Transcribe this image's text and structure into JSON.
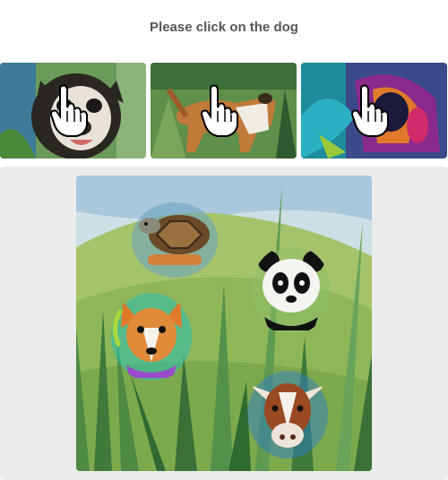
{
  "instruction": "Please click on the dog",
  "examples": [
    {
      "icon": "pointer-hand-icon",
      "subject": "dog"
    },
    {
      "icon": "pointer-hand-icon",
      "subject": "dog"
    },
    {
      "icon": "pointer-hand-icon",
      "subject": "dog"
    }
  ],
  "scene": {
    "animals": [
      "turtle",
      "panda",
      "dog",
      "cow"
    ]
  },
  "colors": {
    "panel_bg": "#ebebeb",
    "text": "#555555"
  }
}
